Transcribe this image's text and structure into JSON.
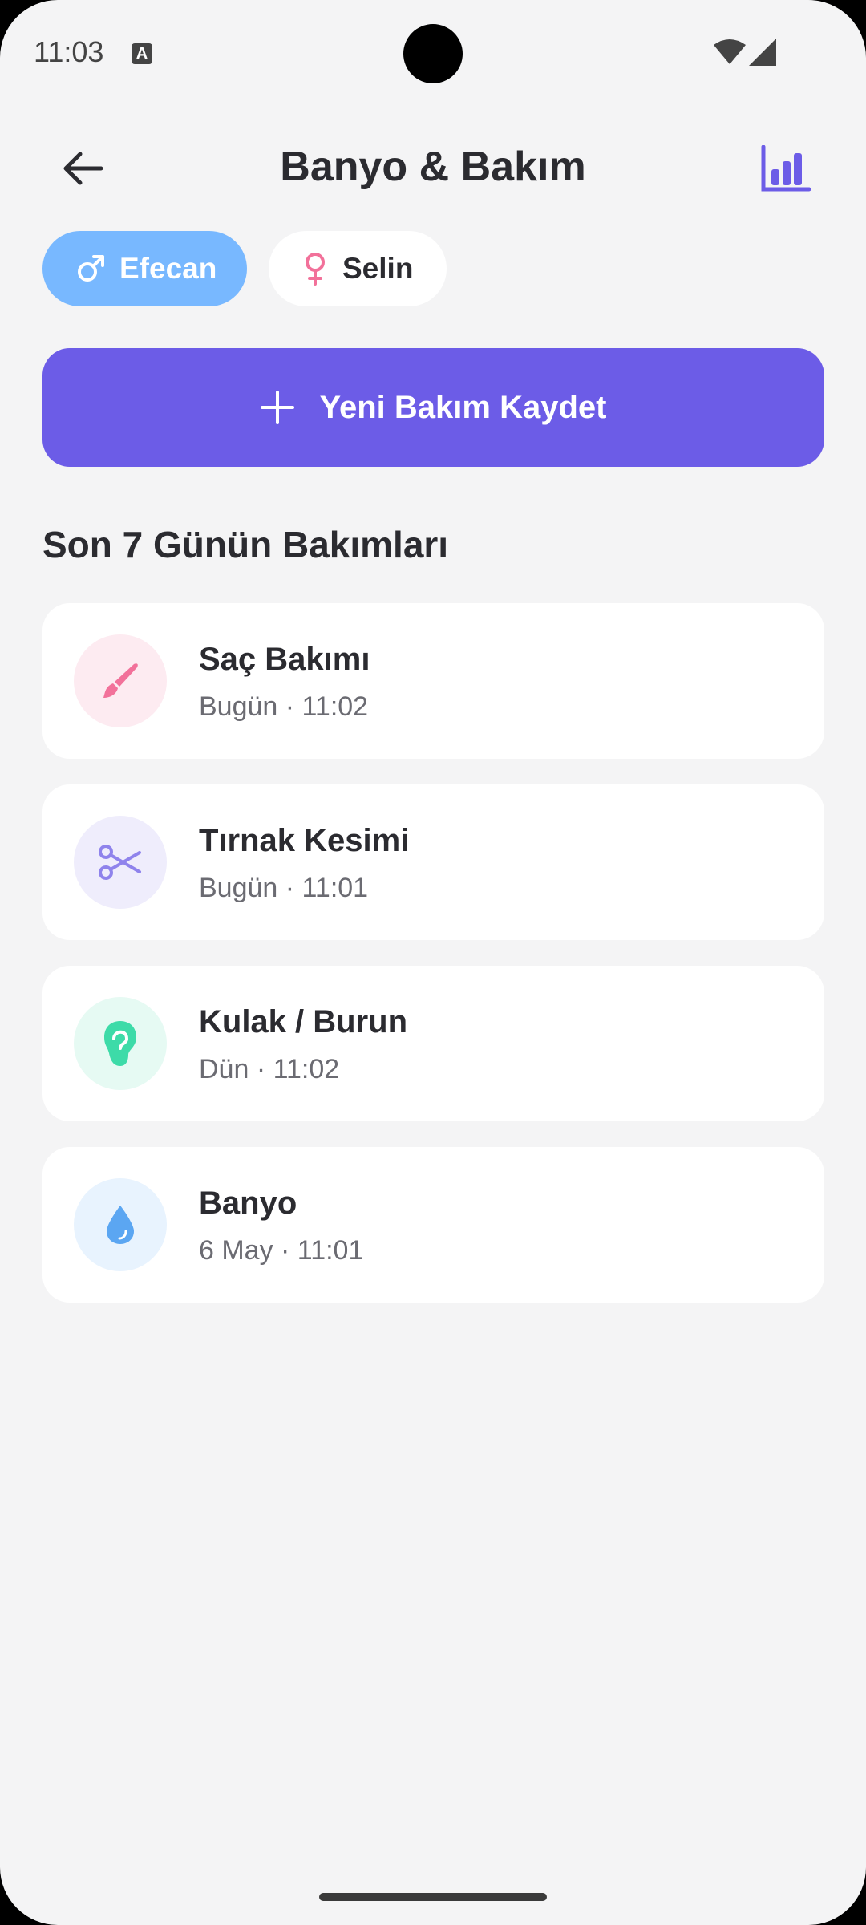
{
  "status_bar": {
    "time": "11:03",
    "notification_glyph": "A"
  },
  "header": {
    "title": "Banyo & Bakım"
  },
  "children": [
    {
      "name": "Efecan",
      "icon": "male-icon",
      "selected": true
    },
    {
      "name": "Selin",
      "icon": "female-icon",
      "selected": false
    }
  ],
  "new_record": {
    "label": "Yeni Bakım Kaydet"
  },
  "section": {
    "title": "Son 7 Günün Bakımları"
  },
  "records": [
    {
      "title": "Saç Bakımı",
      "subtitle": "Bugün · 11:02",
      "icon": "brush-icon",
      "icon_color": "#F2719A",
      "bg_color": "#FDEBF1"
    },
    {
      "title": "Tırnak Kesimi",
      "subtitle": "Bugün · 11:01",
      "icon": "scissors-icon",
      "icon_color": "#8F83EC",
      "bg_color": "#EFEDFC"
    },
    {
      "title": "Kulak / Burun",
      "subtitle": "Dün · 11:02",
      "icon": "ear-icon",
      "icon_color": "#3DDBA8",
      "bg_color": "#E6FAF3"
    },
    {
      "title": "Banyo",
      "subtitle": "6 May · 11:01",
      "icon": "water-drop-icon",
      "icon_color": "#5BA6F2",
      "bg_color": "#E8F3FE"
    }
  ],
  "colors": {
    "accent": "#6C5CE7",
    "chip_active": "#78B8FF",
    "female": "#F2719A",
    "background": "#F4F4F5"
  }
}
